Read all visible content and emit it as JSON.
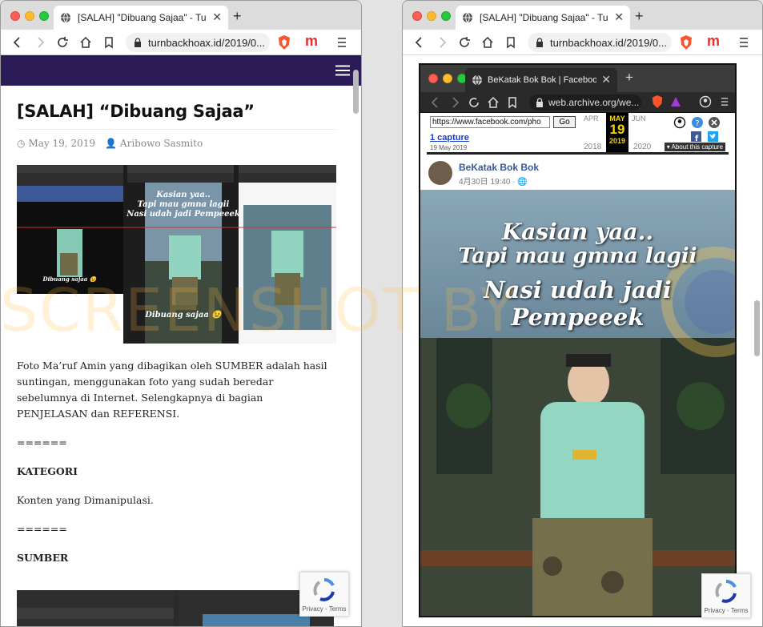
{
  "left_window": {
    "tab_title": "[SALAH] \"Dibuang Sajaa\" - TurnBa",
    "url": "turnbackhoax.id/2019/0...",
    "article": {
      "title": "[SALAH] “Dibuang Sajaa”",
      "date": "May 19, 2019",
      "author": "Aribowo Sasmito",
      "paragraph1": "Foto Ma’ruf Amin yang dibagikan oleh SUMBER adalah hasil suntingan, menggunakan foto yang sudah beredar sebelumnya di Internet. Selengkapnya di bagian PENJELASAN dan REFERENSI.",
      "separator1": "======",
      "category_heading": "KATEGORI",
      "category_value": "Konten yang Dimanipulasi.",
      "separator2": "======",
      "source_heading": "SUMBER"
    },
    "featured_image": {
      "caption_top_line1": "Kasian yaa..",
      "caption_top_line2": "Tapi mau gmna lagii",
      "caption_top_line3": "Nasi udah jadi Pempeeek",
      "caption_bottom": "Dibuang sajaa 😉",
      "caption_left": "Dibuang sajaa 😉"
    }
  },
  "right_window": {
    "tab_title": "[SALAH] \"Dibuang Sajaa\" - TurnBa",
    "url": "turnbackhoax.id/2019/0...",
    "inner": {
      "tab_title": "BeKatak Bok Bok | Facebook",
      "url": "web.archive.org/we...",
      "wayback": {
        "input_value": "https://www.facebook.com/pho",
        "go_label": "Go",
        "captures": "1 capture",
        "capture_date": "19 May 2019",
        "month_prev": "APR",
        "month_current": "MAY",
        "month_next": "JUN",
        "day": "19",
        "year_prev": "2018",
        "year_current": "2019",
        "year_next": "2020",
        "about": "About this capture"
      },
      "facebook_post": {
        "page_name": "BeKatak Bok Bok",
        "post_date": "4月30日 19:40 · "
      },
      "photo_caption": {
        "line1": "Kasian yaa..",
        "line2": "Tapi mau gmna lagii",
        "line3": "Nasi udah jadi Pempeeek"
      }
    }
  },
  "recaptcha": {
    "terms": "Privacy - Terms"
  },
  "watermark": "SCREENSHOT BY",
  "colors": {
    "site_header": "#2b1b57",
    "brave_orange": "#fb542b",
    "wayback_yellow": "#f5d400"
  }
}
